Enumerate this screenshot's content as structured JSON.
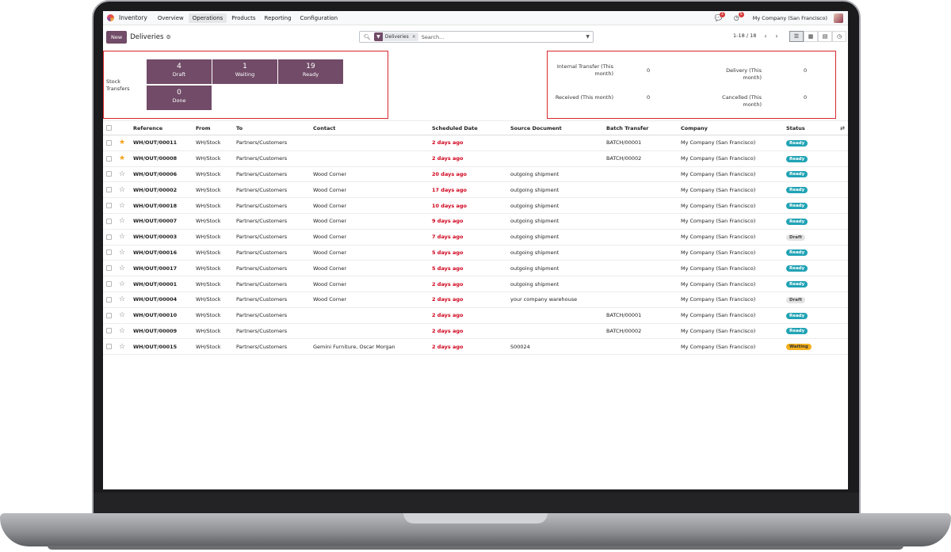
{
  "topbar": {
    "app_name": "Inventory",
    "menu": [
      "Overview",
      "Operations",
      "Products",
      "Reporting",
      "Configuration"
    ],
    "active_menu": "Operations",
    "chat_badge": "3",
    "activity_badge": "5",
    "company": "My Company (San Francisco)"
  },
  "control": {
    "new_label": "New",
    "breadcrumb": "Deliveries",
    "search_facet": "Deliveries",
    "search_placeholder": "Search...",
    "pager": "1-18 / 18"
  },
  "dashboard": {
    "stock_label": "Stock Transfers",
    "tiles": [
      {
        "count": "4",
        "label": "Draft"
      },
      {
        "count": "1",
        "label": "Waiting"
      },
      {
        "count": "19",
        "label": "Ready"
      },
      {
        "count": "0",
        "label": "Done"
      }
    ],
    "stats": [
      {
        "label": "Internal Transfer (This month)",
        "value": "0"
      },
      {
        "label": "Delivery (This month)",
        "value": "0"
      },
      {
        "label": "Received (This month)",
        "value": "0"
      },
      {
        "label": "Cancelled (This month)",
        "value": "0"
      }
    ]
  },
  "table": {
    "columns": [
      "Reference",
      "From",
      "To",
      "Contact",
      "Scheduled Date",
      "Source Document",
      "Batch Transfer",
      "Company",
      "Status"
    ],
    "rows": [
      {
        "fav": true,
        "ref": "WH/OUT/00011",
        "from": "WH/Stock",
        "to": "Partners/Customers",
        "contact": "",
        "date": "2 days ago",
        "source": "",
        "batch": "BATCH/00001",
        "company": "My Company (San Francisco)",
        "status": "Ready"
      },
      {
        "fav": true,
        "ref": "WH/OUT/00008",
        "from": "WH/Stock",
        "to": "Partners/Customers",
        "contact": "",
        "date": "2 days ago",
        "source": "",
        "batch": "BATCH/00002",
        "company": "My Company (San Francisco)",
        "status": "Ready"
      },
      {
        "fav": false,
        "ref": "WH/OUT/00006",
        "from": "WH/Stock",
        "to": "Partners/Customers",
        "contact": "Wood Corner",
        "date": "20 days ago",
        "source": "outgoing shipment",
        "batch": "",
        "company": "My Company (San Francisco)",
        "status": "Ready"
      },
      {
        "fav": false,
        "ref": "WH/OUT/00002",
        "from": "WH/Stock",
        "to": "Partners/Customers",
        "contact": "Wood Corner",
        "date": "17 days ago",
        "source": "outgoing shipment",
        "batch": "",
        "company": "My Company (San Francisco)",
        "status": "Ready"
      },
      {
        "fav": false,
        "ref": "WH/OUT/00018",
        "from": "WH/Stock",
        "to": "Partners/Customers",
        "contact": "Wood Corner",
        "date": "10 days ago",
        "source": "outgoing shipment",
        "batch": "",
        "company": "My Company (San Francisco)",
        "status": "Ready"
      },
      {
        "fav": false,
        "ref": "WH/OUT/00007",
        "from": "WH/Stock",
        "to": "Partners/Customers",
        "contact": "Wood Corner",
        "date": "9 days ago",
        "source": "outgoing shipment",
        "batch": "",
        "company": "My Company (San Francisco)",
        "status": "Ready"
      },
      {
        "fav": false,
        "ref": "WH/OUT/00003",
        "from": "WH/Stock",
        "to": "Partners/Customers",
        "contact": "Wood Corner",
        "date": "7 days ago",
        "source": "outgoing shipment",
        "batch": "",
        "company": "My Company (San Francisco)",
        "status": "Draft"
      },
      {
        "fav": false,
        "ref": "WH/OUT/00016",
        "from": "WH/Stock",
        "to": "Partners/Customers",
        "contact": "Wood Corner",
        "date": "5 days ago",
        "source": "outgoing shipment",
        "batch": "",
        "company": "My Company (San Francisco)",
        "status": "Ready"
      },
      {
        "fav": false,
        "ref": "WH/OUT/00017",
        "from": "WH/Stock",
        "to": "Partners/Customers",
        "contact": "Wood Corner",
        "date": "5 days ago",
        "source": "outgoing shipment",
        "batch": "",
        "company": "My Company (San Francisco)",
        "status": "Ready"
      },
      {
        "fav": false,
        "ref": "WH/OUT/00001",
        "from": "WH/Stock",
        "to": "Partners/Customers",
        "contact": "Wood Corner",
        "date": "2 days ago",
        "source": "outgoing shipment",
        "batch": "",
        "company": "My Company (San Francisco)",
        "status": "Ready"
      },
      {
        "fav": false,
        "ref": "WH/OUT/00004",
        "from": "WH/Stock",
        "to": "Partners/Customers",
        "contact": "Wood Corner",
        "date": "2 days ago",
        "source": "your company warehouse",
        "batch": "",
        "company": "My Company (San Francisco)",
        "status": "Draft"
      },
      {
        "fav": false,
        "ref": "WH/OUT/00010",
        "from": "WH/Stock",
        "to": "Partners/Customers",
        "contact": "",
        "date": "2 days ago",
        "source": "",
        "batch": "BATCH/00001",
        "company": "My Company (San Francisco)",
        "status": "Ready"
      },
      {
        "fav": false,
        "ref": "WH/OUT/00009",
        "from": "WH/Stock",
        "to": "Partners/Customers",
        "contact": "",
        "date": "2 days ago",
        "source": "",
        "batch": "BATCH/00002",
        "company": "My Company (San Francisco)",
        "status": "Ready"
      },
      {
        "fav": false,
        "ref": "WH/OUT/00015",
        "from": "WH/Stock",
        "to": "Partners/Customers",
        "contact": "Gemini Furniture, Oscar Morgan",
        "date": "2 days ago",
        "source": "S00024",
        "batch": "",
        "company": "My Company (San Francisco)",
        "status": "Waiting"
      }
    ]
  },
  "colors": {
    "brand": "#714b67",
    "late": "#d0021b",
    "ready": "#21a3b5",
    "waiting": "#f3b01b",
    "highlight": "#d9262d"
  },
  "icons": [
    "app-logo-icon",
    "chat-icon",
    "activity-icon",
    "gear-icon",
    "search-icon",
    "filter-icon",
    "caret-down-icon",
    "chevron-left-icon",
    "chevron-right-icon",
    "list-view-icon",
    "kanban-view-icon",
    "calendar-view-icon",
    "activity-view-icon",
    "star-icon",
    "optional-columns-icon"
  ]
}
